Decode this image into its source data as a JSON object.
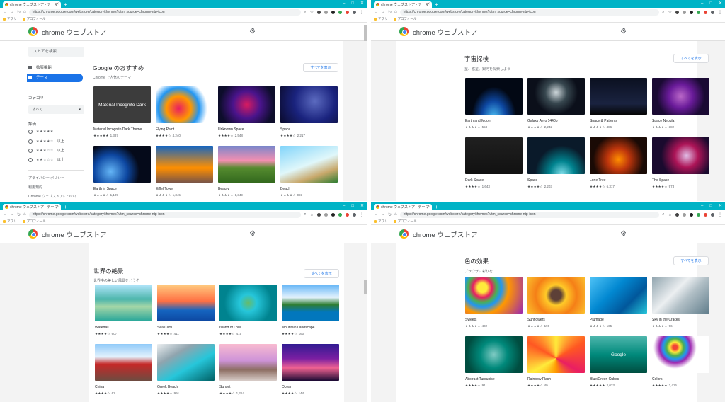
{
  "tab_title": "chrome ウェブストア - テーマ",
  "url": "https://chrome.google.com/webstore/category/themes?utm_source=chrome-ntp-icon",
  "bookmarks": [
    "アプリ",
    "プロフィール"
  ],
  "brand": "chrome ウェブストア",
  "search_placeholder": "ストアを検索",
  "nav": {
    "extensions": "拡張機能",
    "themes": "テーマ"
  },
  "category_label": "カテゴリ",
  "category_value": "すべて",
  "rating_label": "評価",
  "ratings": [
    {
      "stars": "★★★★★",
      "suffix": ""
    },
    {
      "stars": "★★★★☆",
      "suffix": "以上"
    },
    {
      "stars": "★★★☆☆",
      "suffix": "以上"
    },
    {
      "stars": "★★☆☆☆",
      "suffix": "以上"
    }
  ],
  "footer_links": [
    "プライバシー ポリシー",
    "利用規約",
    "Chrome ウェブストアについて"
  ],
  "view_all": "すべてを表示",
  "sections": [
    {
      "title": "Google のおすすめ",
      "subtitle": "Chrome で人気のテーマ",
      "items": [
        {
          "name": "Material Incognito Dark Theme",
          "stars": "★★★★★",
          "count": "1,387",
          "overlay": "Material Incognito Dark",
          "bg": "#3c3c3c"
        },
        {
          "name": "Flying Paint",
          "stars": "★★★★☆",
          "count": "4,240",
          "bg": "radial-gradient(circle at 40% 60%,#e91e63,#ff9800 30%,#2196f3 50%,#fff 70%)"
        },
        {
          "name": "Unknown Space",
          "stars": "★★★★☆",
          "count": "2,548",
          "bg": "radial-gradient(circle at 50% 50%,#d81b60,#4a148c 40%,#0d0d2b 80%)"
        },
        {
          "name": "Space",
          "stars": "★★★★☆",
          "count": "2,217",
          "bg": "radial-gradient(circle at 60% 40%,#5c6bc0,#1a237e 50%,#0a0a2a)"
        },
        {
          "name": "Earth in Space",
          "stars": "★★★★☆",
          "count": "1,109",
          "bg": "radial-gradient(circle at 30% 70%,#64b5f6,#0d47a1 35%,#050a1a 60%)"
        },
        {
          "name": "Eiffel Tower",
          "stars": "★★★★☆",
          "count": "1,345",
          "bg": "linear-gradient(180deg,#1565c0,#ff8f00 60%,#795548)"
        },
        {
          "name": "Beauty",
          "stars": "★★★★☆",
          "count": "1,349",
          "bg": "linear-gradient(180deg,#7986cb,#f48fb1 40%,#558b2f 60%,#33691e)"
        },
        {
          "name": "Beach",
          "stars": "★★★★☆",
          "count": "993",
          "bg": "linear-gradient(160deg,#81d4fa,#e0f7fa 50%,#c8a86b 75%,#2e7d32)"
        }
      ]
    },
    {
      "title": "宇宙探検",
      "subtitle": "星、惑星、銀河を探索しよう",
      "items": [
        {
          "name": "Earth and Moon",
          "stars": "★★★★☆",
          "count": "558",
          "bg": "radial-gradient(ellipse at 50% 110%,#4fc3f7,#0d47a1 30%,#020814 55%)"
        },
        {
          "name": "Galaxy Aero 1440p",
          "stars": "★★★★☆",
          "count": "2,242",
          "bg": "radial-gradient(circle at 50% 40%,#cfd8dc,#37474f 30%,#0b0f1a 60%)"
        },
        {
          "name": "Space & Patterns",
          "stars": "★★★★☆",
          "count": "486",
          "bg": "linear-gradient(180deg,#0b1020,#1a2340 70%,#050505)"
        },
        {
          "name": "Space Nebula",
          "stars": "★★★★☆",
          "count": "382",
          "bg": "radial-gradient(circle at 50% 50%,#ba68c8,#6a1b9a 35%,#1a0a33 70%)"
        },
        {
          "name": "Dark Space",
          "stars": "★★★★☆",
          "count": "1,643",
          "bg": "linear-gradient(180deg,#202020,#111)"
        },
        {
          "name": "Space",
          "stars": "★★★★☆",
          "count": "2,203",
          "bg": "radial-gradient(ellipse at 60% 100%,#80deea,#00838f 25%,#0a1a2a 55%)"
        },
        {
          "name": "Lone Tree",
          "stars": "★★★★☆",
          "count": "6,317",
          "bg": "radial-gradient(circle at 50% 60%,#ff8f00,#bf360c 30%,#1a0a05 70%)"
        },
        {
          "name": "The Space",
          "stars": "★★★★☆",
          "count": "973",
          "bg": "radial-gradient(circle at 60% 50%,#e1bee7,#ad1457 30%,#1a0a2e 65%)"
        }
      ]
    },
    {
      "title": "世界の絶景",
      "subtitle": "世界中の美しい風景をどうぞ",
      "items": [
        {
          "name": "Waterfall",
          "stars": "★★★★☆",
          "count": "607",
          "bg": "linear-gradient(180deg,#b3e5fc,#4db6ac 40%,#a5d6a7 60%,#26a69a)"
        },
        {
          "name": "Sea Cliffs",
          "stars": "★★★★☆",
          "count": "411",
          "bg": "linear-gradient(180deg,#ffcc80,#ff7043 45%,#1565c0 70%,#0d47a1)"
        },
        {
          "name": "Island of Love",
          "stars": "★★★★☆",
          "count": "415",
          "bg": "radial-gradient(circle at 50% 50%,#66bb6a,#26c6da 25%,#00838f 70%)"
        },
        {
          "name": "Mountain Landscape",
          "stars": "★★★★☆",
          "count": "160",
          "bg": "linear-gradient(180deg,#64b5f6,#e3f2fd 35%,#2e7d32 55%,#0277bd 75%)"
        },
        {
          "name": "China",
          "stars": "★★★★☆",
          "count": "62",
          "bg": "linear-gradient(180deg,#90caf9,#e3f2fd 35%,#c62828 55%,#6d4c41)"
        },
        {
          "name": "Greek Beach",
          "stars": "★★★★☆",
          "count": "991",
          "bg": "linear-gradient(150deg,#eceff1,#90a4ae 30%,#26c6da 60%,#006064)"
        },
        {
          "name": "Sunset",
          "stars": "★★★★☆",
          "count": "1,214",
          "bg": "linear-gradient(180deg,#f8bbd0,#ce93d8 45%,#8d6e63 70%,#d7ccc8)"
        },
        {
          "name": "Ocean",
          "stars": "★★★★☆",
          "count": "144",
          "bg": "linear-gradient(180deg,#311b92,#7b1fa2 40%,#f06292 65%,#1a0a33)"
        }
      ]
    },
    {
      "title": "色の効果",
      "subtitle": "ブラウザに彩りを",
      "items": [
        {
          "name": "Sweets",
          "stars": "★★★★☆",
          "count": "432",
          "bg": "radial-gradient(circle at 30% 30%,#ffeb3b 10%,#e91e63 20%,#4caf50 30%,#2196f3 40%,#ff9800 55%,#9c27b0)"
        },
        {
          "name": "Sunflowers",
          "stars": "★★★★☆",
          "count": "196",
          "bg": "radial-gradient(circle at 50% 50%,#5d4037 15%,#ffca28 30%,#f57f17 60%,#fbc02d)"
        },
        {
          "name": "Plumage",
          "stars": "★★★★☆",
          "count": "165",
          "bg": "linear-gradient(135deg,#4fc3f7,#0288d1 40%,#01579b 70%,#26c6da)"
        },
        {
          "name": "Sky in the Cracks",
          "stars": "★★★★☆",
          "count": "96",
          "bg": "linear-gradient(135deg,#90a4ae,#eceff1 40%,#b0bec5 60%,#607d8b)"
        },
        {
          "name": "Abstract Turquoise",
          "stars": "★★★★☆",
          "count": "91",
          "bg": "radial-gradient(circle at 50% 50%,#80cbc4,#00897b 40%,#004d40 80%)"
        },
        {
          "name": "Rainbow Flash",
          "stars": "★★★★☆",
          "count": "49",
          "bg": "conic-gradient(from 0deg at 50% 60%,#ffeb3b,#ff5722,#e91e63,#ff9800,#ffeb3b,#ff5722,#ffeb3b)"
        },
        {
          "name": "Blue/Green Cubes",
          "stars": "★★★★★",
          "count": "2,033",
          "overlay": "Google",
          "bg": "linear-gradient(180deg,#4db6ac,#00897b 50%,#004d40)"
        },
        {
          "name": "Colors",
          "stars": "★★★★★",
          "count": "2,416",
          "bg": "radial-gradient(circle at 40% 30%,#f44336 5%,#ffeb3b 12%,#4caf50 20%,#2196f3 28%,#9c27b0 36%,#fff 50%)"
        }
      ]
    }
  ]
}
